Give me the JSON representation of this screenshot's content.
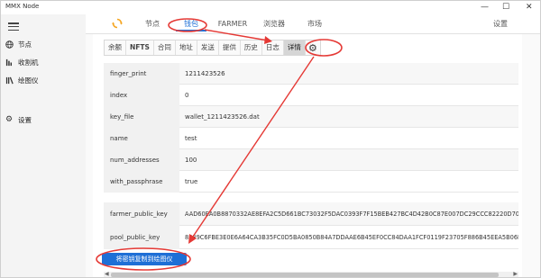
{
  "window": {
    "title": "MMX Node",
    "minimize": "—",
    "maximize": "☐",
    "close": "✕"
  },
  "sidebar": {
    "items": [
      {
        "label": "节点",
        "icon": "globe-icon"
      },
      {
        "label": "收割机",
        "icon": "harvester-icon"
      },
      {
        "label": "绘图仪",
        "icon": "plotter-icon"
      },
      {
        "label": "设置",
        "icon": "gear-icon"
      }
    ]
  },
  "topnav": {
    "tabs": [
      "节点",
      "钱包",
      "FARMER",
      "浏览器",
      "市场"
    ],
    "active": "钱包",
    "settings": "设置"
  },
  "subtabs": {
    "items": [
      "余额",
      "NFTS",
      "合同",
      "地址",
      "发送",
      "提供",
      "历史",
      "日志",
      "详情"
    ],
    "active": "详情"
  },
  "details": [
    {
      "key": "finger_print",
      "value": "1211423526"
    },
    {
      "key": "index",
      "value": "0"
    },
    {
      "key": "key_file",
      "value": "wallet_1211423526.dat"
    },
    {
      "key": "name",
      "value": "test"
    },
    {
      "key": "num_addresses",
      "value": "100"
    },
    {
      "key": "with_passphrase",
      "value": "true"
    }
  ],
  "keys": [
    {
      "key": "farmer_public_key",
      "value": "AAD60EA0B8870332AE8EFA2C5D661BC73032F5DAC0393F7F15BEB427BC4D42B0C87E007DC29CCC82220D706CCAD"
    },
    {
      "key": "pool_public_key",
      "value": "8539C6FBE3E0E6A64CA3B35FC0D5BA0850B84A7DDAAE6B45EF0CC84DAA1FCF0119F23705F886B45EEA5B06D3471C"
    }
  ],
  "copy_button": "将密钥复制到绘图仪",
  "accent_color": "#1e6fd6",
  "annotation_color": "#e53935"
}
